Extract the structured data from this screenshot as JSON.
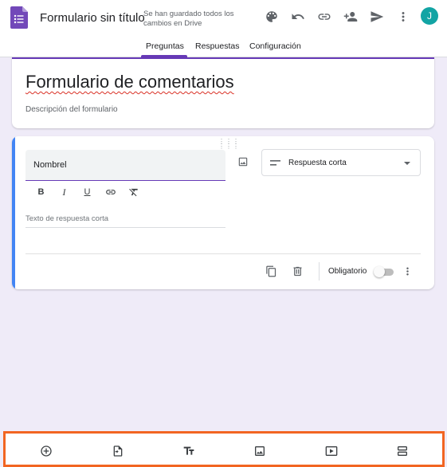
{
  "header": {
    "doc_title": "Formulario sin título",
    "save_status": "Se han guardado todos los cambios en Drive",
    "avatar_initial": "J",
    "accent_color": "#673ab7",
    "icons": [
      "palette-icon",
      "undo-icon",
      "link-icon",
      "add-person-icon",
      "send-icon",
      "more-vert-icon"
    ]
  },
  "tabs": [
    {
      "label": "Preguntas",
      "active": true
    },
    {
      "label": "Respuestas",
      "active": false
    },
    {
      "label": "Configuración",
      "active": false
    }
  ],
  "form": {
    "title": "Formulario de comentarios",
    "description_placeholder": "Descripción del formulario"
  },
  "question": {
    "title": "Nombrel",
    "type_label": "Respuesta corta",
    "answer_placeholder": "Texto de respuesta corta",
    "required_label": "Obligatorio",
    "required_on": false,
    "format_icons": [
      "bold-icon",
      "italic-icon",
      "underline-icon",
      "link-icon",
      "clear-format-icon"
    ]
  },
  "bottom_toolbar": {
    "highlight_color": "#f26522",
    "icons": [
      "add-question-icon",
      "import-questions-icon",
      "add-title-icon",
      "add-image-icon",
      "add-video-icon",
      "add-section-icon"
    ]
  }
}
